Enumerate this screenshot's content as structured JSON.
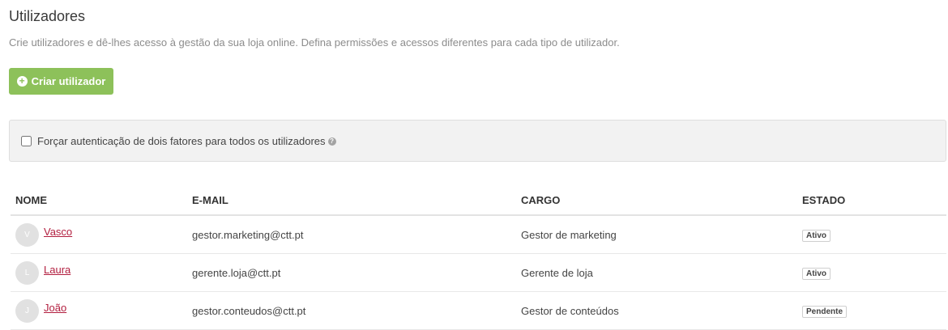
{
  "header": {
    "title": "Utilizadores",
    "description": "Crie utilizadores e dê-lhes acesso à gestão da sua loja online. Defina permissões e acessos diferentes para cada tipo de utilizador."
  },
  "actions": {
    "create_user_label": "Criar utilizador",
    "create_user_icon": "plus-circle-icon"
  },
  "two_factor": {
    "label": "Forçar autenticação de dois fatores para todos os utilizadores",
    "checked": false,
    "help_icon": "question-circle-icon"
  },
  "table": {
    "columns": [
      "NOME",
      "E-MAIL",
      "CARGO",
      "ESTADO"
    ],
    "rows": [
      {
        "initial": "V",
        "name": "Vasco",
        "email": "gestor.marketing@ctt.pt",
        "role": "Gestor de marketing",
        "status": "Ativo"
      },
      {
        "initial": "L",
        "name": "Laura",
        "email": "gerente.loja@ctt.pt",
        "role": "Gerente de loja",
        "status": "Ativo"
      },
      {
        "initial": "J",
        "name": "João",
        "email": "gestor.conteudos@ctt.pt",
        "role": "Gestor de conteúdos",
        "status": "Pendente"
      }
    ]
  },
  "colors": {
    "accent_green": "#8dc15a",
    "link_red": "#b21e3f"
  }
}
